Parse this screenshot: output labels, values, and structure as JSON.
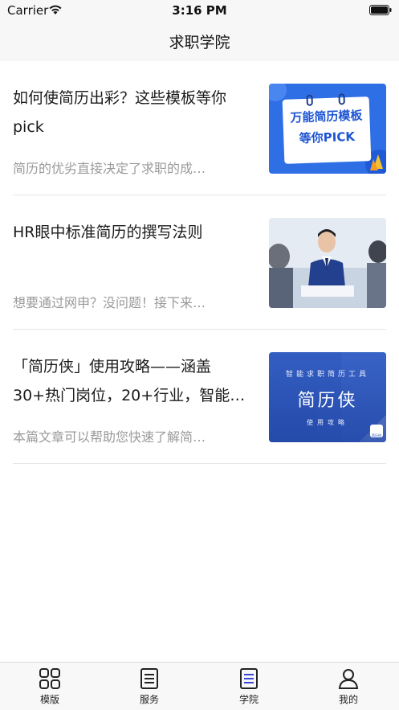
{
  "status_bar": {
    "carrier": "Carrier",
    "time": "3:16 PM"
  },
  "nav": {
    "title": "求职学院"
  },
  "articles": [
    {
      "title": "如何使简历出彩？这些模板等你pick",
      "desc": "简历的优劣直接决定了求职的成…",
      "thumb": {
        "line1": "万能简历模板",
        "line2": "等你PICK"
      }
    },
    {
      "title": "HR眼中标准简历的撰写法则",
      "desc": "想要通过网申？没问题！接下来…"
    },
    {
      "title": "「简历侠」使用攻略——涵盖30+热门岗位，20+行业，智能…",
      "desc": "本篇文章可以帮助您快速了解简…",
      "thumb": {
        "top": "智能求职简历工具",
        "main": "简历侠",
        "bottom": "使用攻略",
        "badge": "简历侠"
      }
    }
  ],
  "tabs": [
    {
      "label": "模版",
      "icon": "grid-icon"
    },
    {
      "label": "服务",
      "icon": "document-icon"
    },
    {
      "label": "学院",
      "icon": "list-document-icon",
      "active": true
    },
    {
      "label": "我的",
      "icon": "person-icon"
    }
  ],
  "colors": {
    "accent": "#2f6fe5",
    "active_tab": "#3b45d6",
    "text_muted": "#9a9a9a"
  }
}
